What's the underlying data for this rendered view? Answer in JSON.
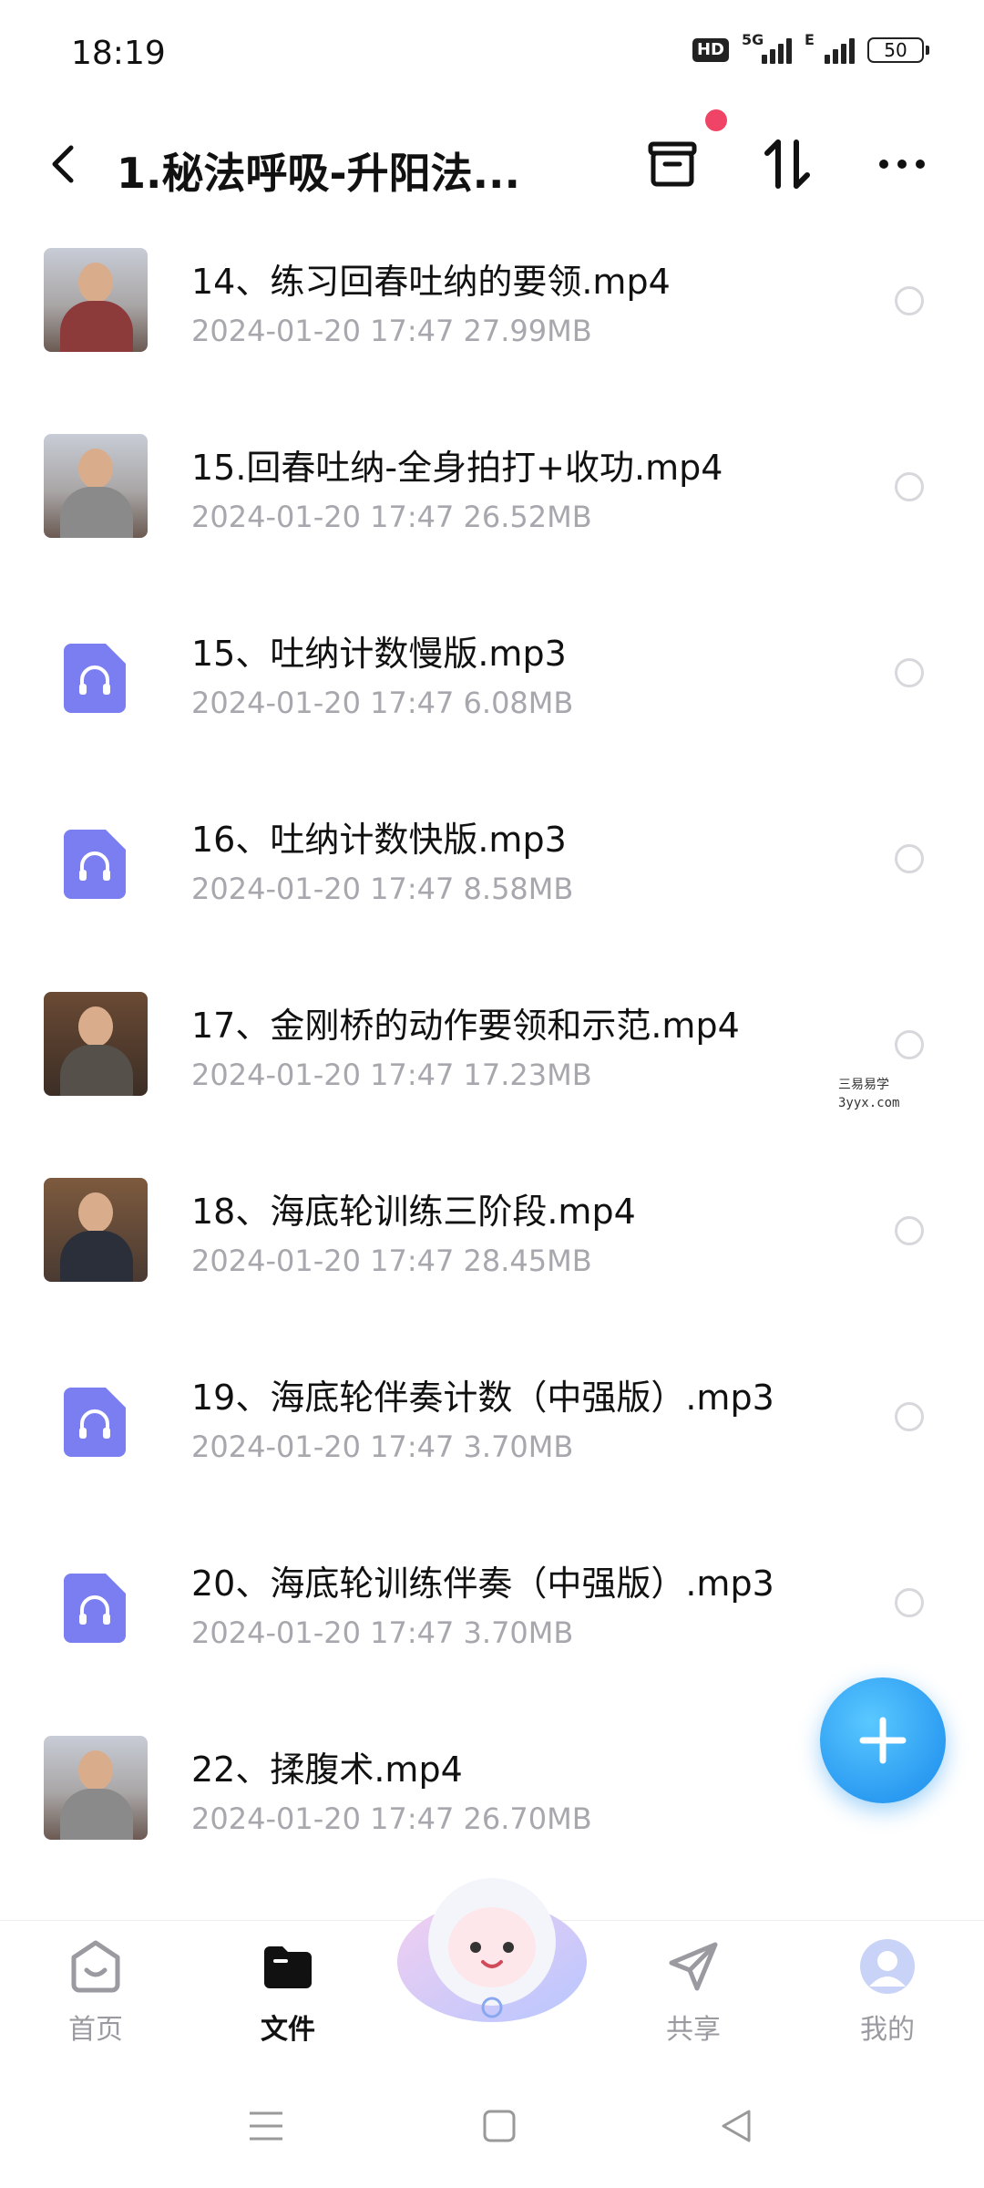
{
  "status_bar": {
    "time": "18:19",
    "hd_label": "HD",
    "network_1": "5G",
    "network_2": "E",
    "battery": "50"
  },
  "header": {
    "title": "1.秘法呼吸-升阳法..."
  },
  "files": [
    {
      "name": "14、练习回春吐纳的要领.mp4",
      "date": "2024-01-20",
      "time": "17:47",
      "size": "27.99MB",
      "type": "video"
    },
    {
      "name": "15.回春吐纳-全身拍打+收功.mp4",
      "date": "2024-01-20",
      "time": "17:47",
      "size": "26.52MB",
      "type": "video"
    },
    {
      "name": "15、吐纳计数慢版.mp3",
      "date": "2024-01-20",
      "time": "17:47",
      "size": "6.08MB",
      "type": "audio"
    },
    {
      "name": "16、吐纳计数快版.mp3",
      "date": "2024-01-20",
      "time": "17:47",
      "size": "8.58MB",
      "type": "audio"
    },
    {
      "name": "17、金刚桥的动作要领和示范.mp4",
      "date": "2024-01-20",
      "time": "17:47",
      "size": "17.23MB",
      "type": "video"
    },
    {
      "name": "18、海底轮训练三阶段.mp4",
      "date": "2024-01-20",
      "time": "17:47",
      "size": "28.45MB",
      "type": "video"
    },
    {
      "name": "19、海底轮伴奏计数（中强版）.mp3",
      "date": "2024-01-20",
      "time": "17:47",
      "size": "3.70MB",
      "type": "audio"
    },
    {
      "name": "20、海底轮训练伴奏（中强版）.mp3",
      "date": "2024-01-20",
      "time": "17:47",
      "size": "3.70MB",
      "type": "audio"
    },
    {
      "name": "22、揉腹术.mp4",
      "date": "2024-01-20",
      "time": "17:47",
      "size": "26.70MB",
      "type": "video"
    }
  ],
  "watermark": {
    "line1": "三易易学",
    "line2": "3yyx.com"
  },
  "bottom_nav": {
    "home": "首页",
    "files": "文件",
    "share": "共享",
    "mine": "我的"
  },
  "colors": {
    "accent": "#2c9cf2",
    "audio_icon": "#7b7ef0",
    "notification_dot": "#f04466",
    "meta_text": "#a7a7ad"
  }
}
